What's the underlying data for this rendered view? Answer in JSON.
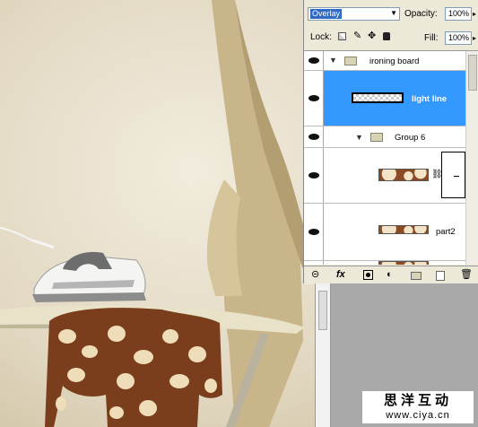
{
  "layers_panel": {
    "blend_mode": "Overlay",
    "opacity_label": "Opacity:",
    "opacity_value": "100%",
    "lock_label": "Lock:",
    "fill_label": "Fill:",
    "fill_value": "100%",
    "layers": [
      {
        "name": "ironing board",
        "type": "group",
        "expanded": true,
        "visible": true
      },
      {
        "name": "light line",
        "type": "layer",
        "selected": true,
        "visible": true
      },
      {
        "name": "Group 6",
        "type": "group",
        "expanded": true,
        "visible": true
      },
      {
        "name": "",
        "type": "masked-layer",
        "visible": true
      },
      {
        "name": "part2",
        "type": "layer",
        "visible": true
      }
    ],
    "footer_icons": [
      "link-icon",
      "fx-icon",
      "mask-icon",
      "adjustment-icon",
      "folder-icon",
      "new-layer-icon",
      "trash-icon"
    ],
    "fx_label": "fx"
  },
  "watermark": {
    "line1": "思洋互动",
    "line2": "www.ciya.cn"
  },
  "colors": {
    "selection": "#3399ff",
    "panel_bg": "#ece9d8",
    "canvas_bg": "#e7dfcc"
  }
}
